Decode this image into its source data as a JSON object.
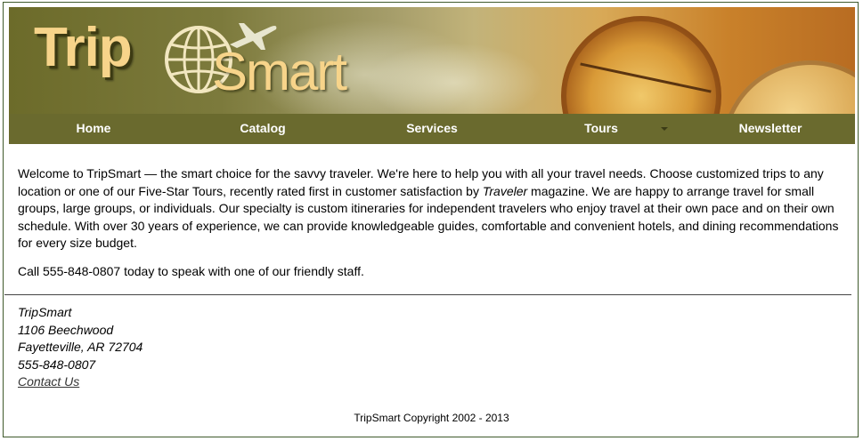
{
  "logo": {
    "trip": "Trip",
    "smart": "Smart"
  },
  "nav": {
    "items": [
      {
        "label": "Home"
      },
      {
        "label": "Catalog"
      },
      {
        "label": "Services"
      },
      {
        "label": "Tours"
      },
      {
        "label": "Newsletter"
      }
    ]
  },
  "main": {
    "intro_1": "Welcome to TripSmart — the smart choice for the savvy traveler. We're here to help you with all your travel needs. Choose customized trips to any location or one of our Five-Star Tours, recently rated first in customer satisfaction by ",
    "intro_emph": "Traveler",
    "intro_2": " magazine. We are happy to arrange travel for small groups, large groups, or individuals. Our specialty is custom itineraries for independent travelers who enjoy travel at their own pace and on their own schedule. With over 30 years of experience, we can provide knowledgeable guides, comfortable and convenient hotels, and dining recommendations for every size budget.",
    "call": "Call 555-848-0807 today to speak with one of our friendly staff."
  },
  "footer": {
    "company": "TripSmart",
    "street": "1106 Beechwood",
    "city": "Fayetteville, AR 72704",
    "phone": "555-848-0807",
    "contact_link": "Contact Us",
    "copyright": "TripSmart Copyright 2002 - 2013"
  },
  "colors": {
    "nav_bg": "#6a6a2e",
    "border": "#3f5a2c",
    "logo": "#f7d48a"
  }
}
